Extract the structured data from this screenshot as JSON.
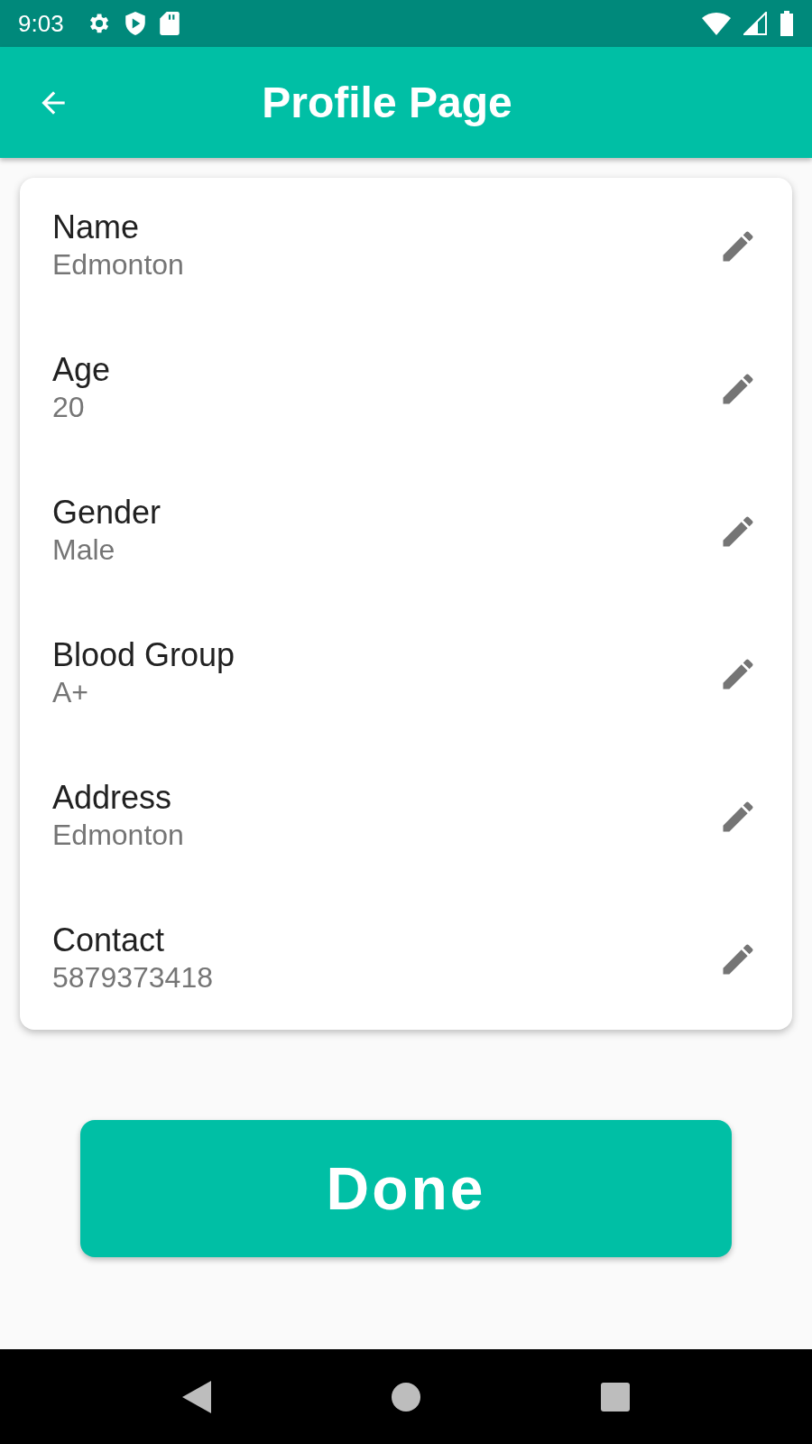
{
  "status_bar": {
    "time": "9:03"
  },
  "app_bar": {
    "title": "Profile Page"
  },
  "fields": [
    {
      "label": "Name",
      "value": "Edmonton"
    },
    {
      "label": "Age",
      "value": "20"
    },
    {
      "label": "Gender",
      "value": "Male"
    },
    {
      "label": "Blood Group",
      "value": "A+"
    },
    {
      "label": "Address",
      "value": "Edmonton"
    },
    {
      "label": "Contact",
      "value": "5879373418"
    }
  ],
  "done_button": {
    "label": "Done"
  }
}
